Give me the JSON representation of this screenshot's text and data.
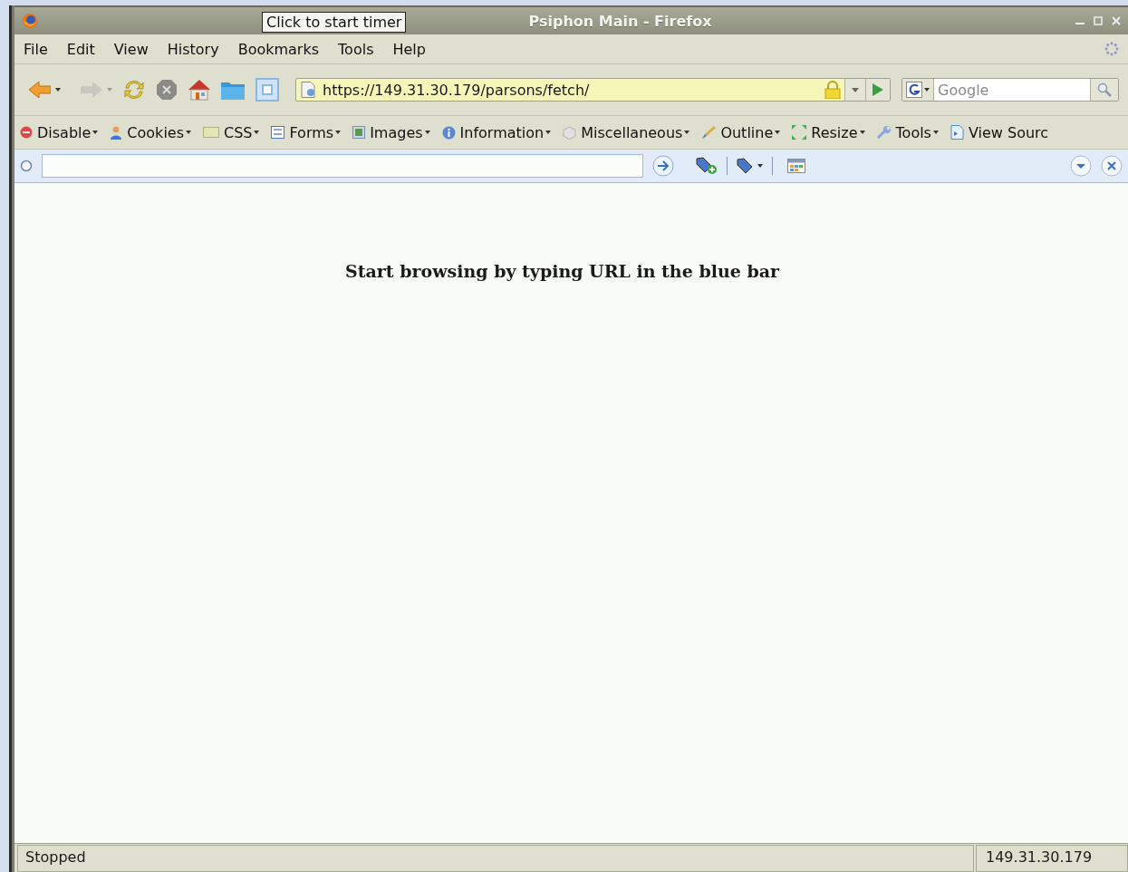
{
  "window": {
    "title": "Psiphon Main - Firefox"
  },
  "tooltip": "Click to start timer",
  "menu": [
    "File",
    "Edit",
    "View",
    "History",
    "Bookmarks",
    "Tools",
    "Help"
  ],
  "navigation": {
    "url": "https://149.31.30.179/parsons/fetch/",
    "search_placeholder": "Google"
  },
  "dev_toolbar": [
    {
      "label": "Disable",
      "kind": "disable",
      "dropdown": true
    },
    {
      "label": "Cookies",
      "kind": "cookies",
      "dropdown": true
    },
    {
      "label": "CSS",
      "kind": "css",
      "dropdown": true
    },
    {
      "label": "Forms",
      "kind": "forms",
      "dropdown": true
    },
    {
      "label": "Images",
      "kind": "images",
      "dropdown": true
    },
    {
      "label": "Information",
      "kind": "information",
      "dropdown": true
    },
    {
      "label": "Miscellaneous",
      "kind": "misc",
      "dropdown": true
    },
    {
      "label": "Outline",
      "kind": "outline",
      "dropdown": true
    },
    {
      "label": "Resize",
      "kind": "resize",
      "dropdown": true
    },
    {
      "label": "Tools",
      "kind": "tools",
      "dropdown": true
    },
    {
      "label": "View Sourc",
      "kind": "source",
      "dropdown": false
    }
  ],
  "page": {
    "message": "Start browsing by typing URL in the blue bar"
  },
  "status_bar": {
    "text": "Stopped",
    "host": "149.31.30.179"
  }
}
